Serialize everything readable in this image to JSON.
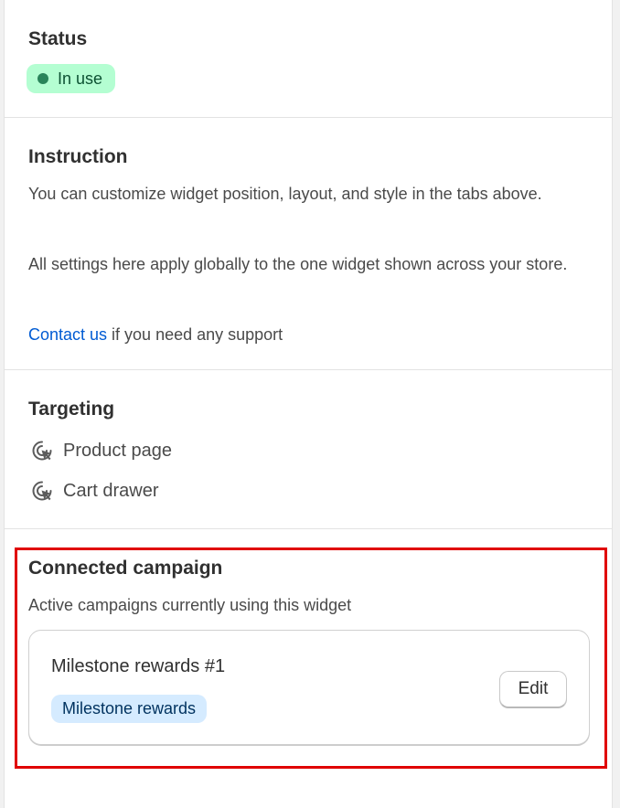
{
  "status": {
    "heading": "Status",
    "badge_label": "In use",
    "badge_color": "#b4fed2",
    "dot_color": "#29845a"
  },
  "instruction": {
    "heading": "Instruction",
    "paragraph1": "You can customize widget position, layout, and style in the tabs above.",
    "paragraph2": "All settings here apply globally to the one widget shown across your store.",
    "contact_link": "Contact us",
    "contact_suffix": " if you need any support"
  },
  "targeting": {
    "heading": "Targeting",
    "icon": "cursor-target-icon",
    "items": [
      {
        "label": "Product page"
      },
      {
        "label": "Cart drawer"
      }
    ]
  },
  "connected_campaign": {
    "heading": "Connected campaign",
    "description": "Active campaigns currently using this widget",
    "highlight_color": "#e00000",
    "campaigns": [
      {
        "name": "Milestone rewards #1",
        "tag": "Milestone rewards",
        "edit_label": "Edit"
      }
    ]
  }
}
